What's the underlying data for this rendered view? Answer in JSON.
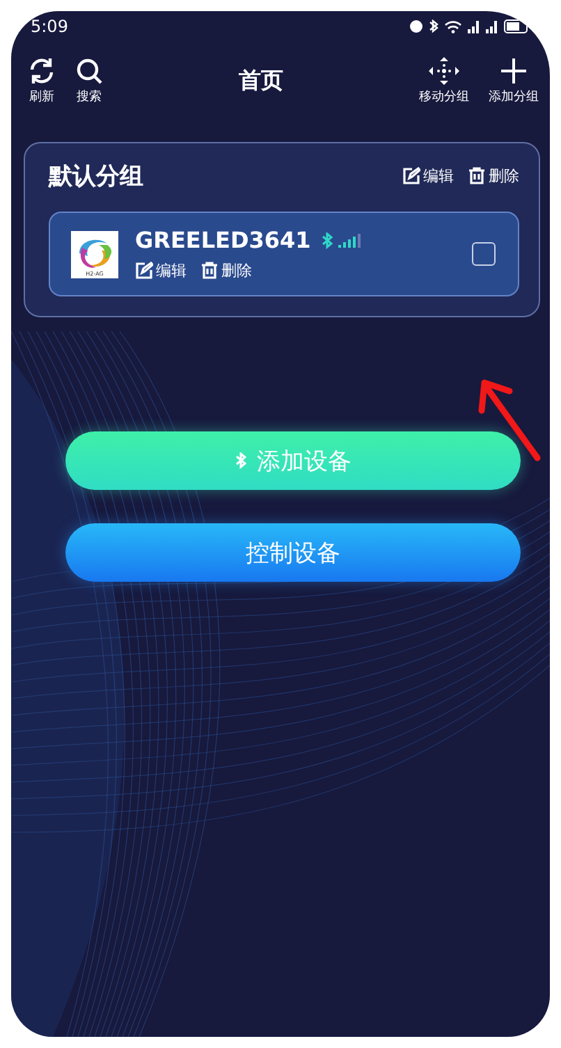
{
  "status_bar": {
    "time": "5:09"
  },
  "header": {
    "title": "首页",
    "left_actions": [
      {
        "kind": "refresh",
        "label": "刷新"
      },
      {
        "kind": "search",
        "label": "搜索"
      }
    ],
    "right_actions": [
      {
        "kind": "move",
        "label": "移动分组"
      },
      {
        "kind": "add",
        "label": "添加分组"
      }
    ]
  },
  "group": {
    "title": "默认分组",
    "actions": [
      {
        "kind": "edit",
        "label": "编辑"
      },
      {
        "kind": "delete",
        "label": "删除"
      }
    ],
    "devices": [
      {
        "name": "GREELED3641",
        "logo_text": "H2-AG",
        "checked": false,
        "actions": [
          {
            "kind": "edit",
            "label": "编辑"
          },
          {
            "kind": "delete",
            "label": "删除"
          }
        ]
      }
    ]
  },
  "buttons": [
    {
      "kind": "bluetooth",
      "label": "添加设备"
    },
    {
      "kind": "plain",
      "label": "控制设备"
    }
  ],
  "annotation": {
    "kind": "arrow"
  }
}
